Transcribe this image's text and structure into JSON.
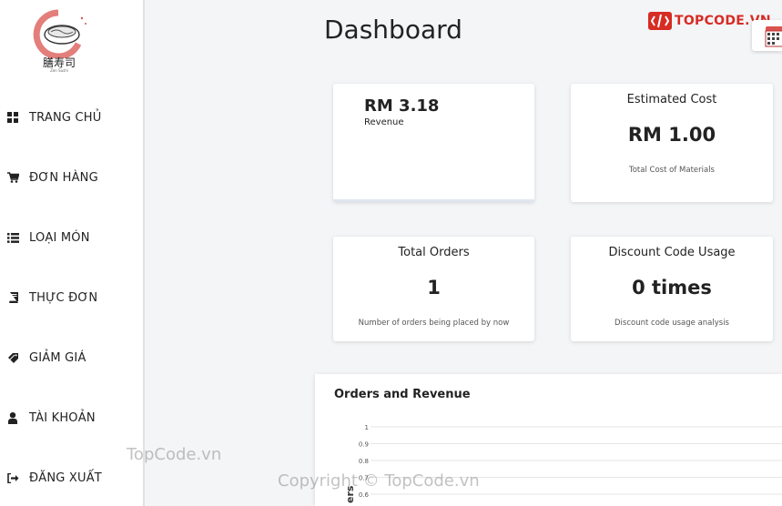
{
  "sidebar": {
    "logo": {
      "name": "膳寿司",
      "sub": "Zen Sushi"
    },
    "items": [
      {
        "label": "TRANG CHỦ",
        "icon": "dashboard-grid-icon"
      },
      {
        "label": "ĐƠN HÀNG",
        "icon": "cart-icon"
      },
      {
        "label": "LOẠI MÓN",
        "icon": "list-icon"
      },
      {
        "label": "THỰC ĐƠN",
        "icon": "book-icon"
      },
      {
        "label": "GIẢM GIÁ",
        "icon": "tag-icon"
      },
      {
        "label": "TÀI KHOẢN",
        "icon": "user-icon"
      },
      {
        "label": "ĐĂNG XUẤT",
        "icon": "sign-out-icon"
      }
    ]
  },
  "header": {
    "title": "Dashboard",
    "brand": "TOPCODE.VN"
  },
  "cards": {
    "revenue": {
      "value": "RM 3.18",
      "label": "Revenue"
    },
    "cost": {
      "title": "Estimated Cost",
      "value": "RM 1.00",
      "sub": "Total Cost of Materials"
    },
    "orders": {
      "title": "Total Orders",
      "value": "1",
      "sub": "Number of orders being placed by now"
    },
    "discount": {
      "title": "Discount Code Usage",
      "value": "0 times",
      "sub": "Discount code usage analysis"
    }
  },
  "chart_data": {
    "type": "line",
    "title": "Orders and Revenue",
    "ylabel": "ers",
    "y_ticks": [
      "1",
      "0.9",
      "0.8",
      "0.7",
      "0.6"
    ],
    "ylim": [
      0.6,
      1
    ],
    "grid": true
  },
  "watermarks": {
    "left": "TopCode.vn",
    "bottom": "Copyright © TopCode.vn"
  },
  "colors": {
    "brand_red": "#d72c24",
    "background": "#f4f5f7"
  }
}
